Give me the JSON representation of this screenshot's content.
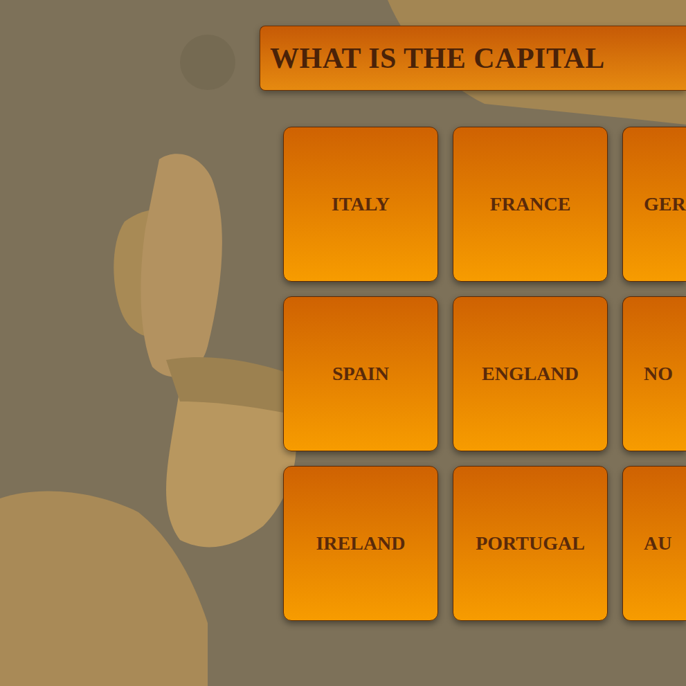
{
  "question": {
    "title": "WHAT IS THE CAPITAL"
  },
  "answers": [
    {
      "label": "ITALY"
    },
    {
      "label": "FRANCE"
    },
    {
      "label": "GER"
    },
    {
      "label": "SPAIN"
    },
    {
      "label": "ENGLAND"
    },
    {
      "label": "NO"
    },
    {
      "label": "IRELAND"
    },
    {
      "label": "PORTUGAL"
    },
    {
      "label": "AU"
    }
  ]
}
